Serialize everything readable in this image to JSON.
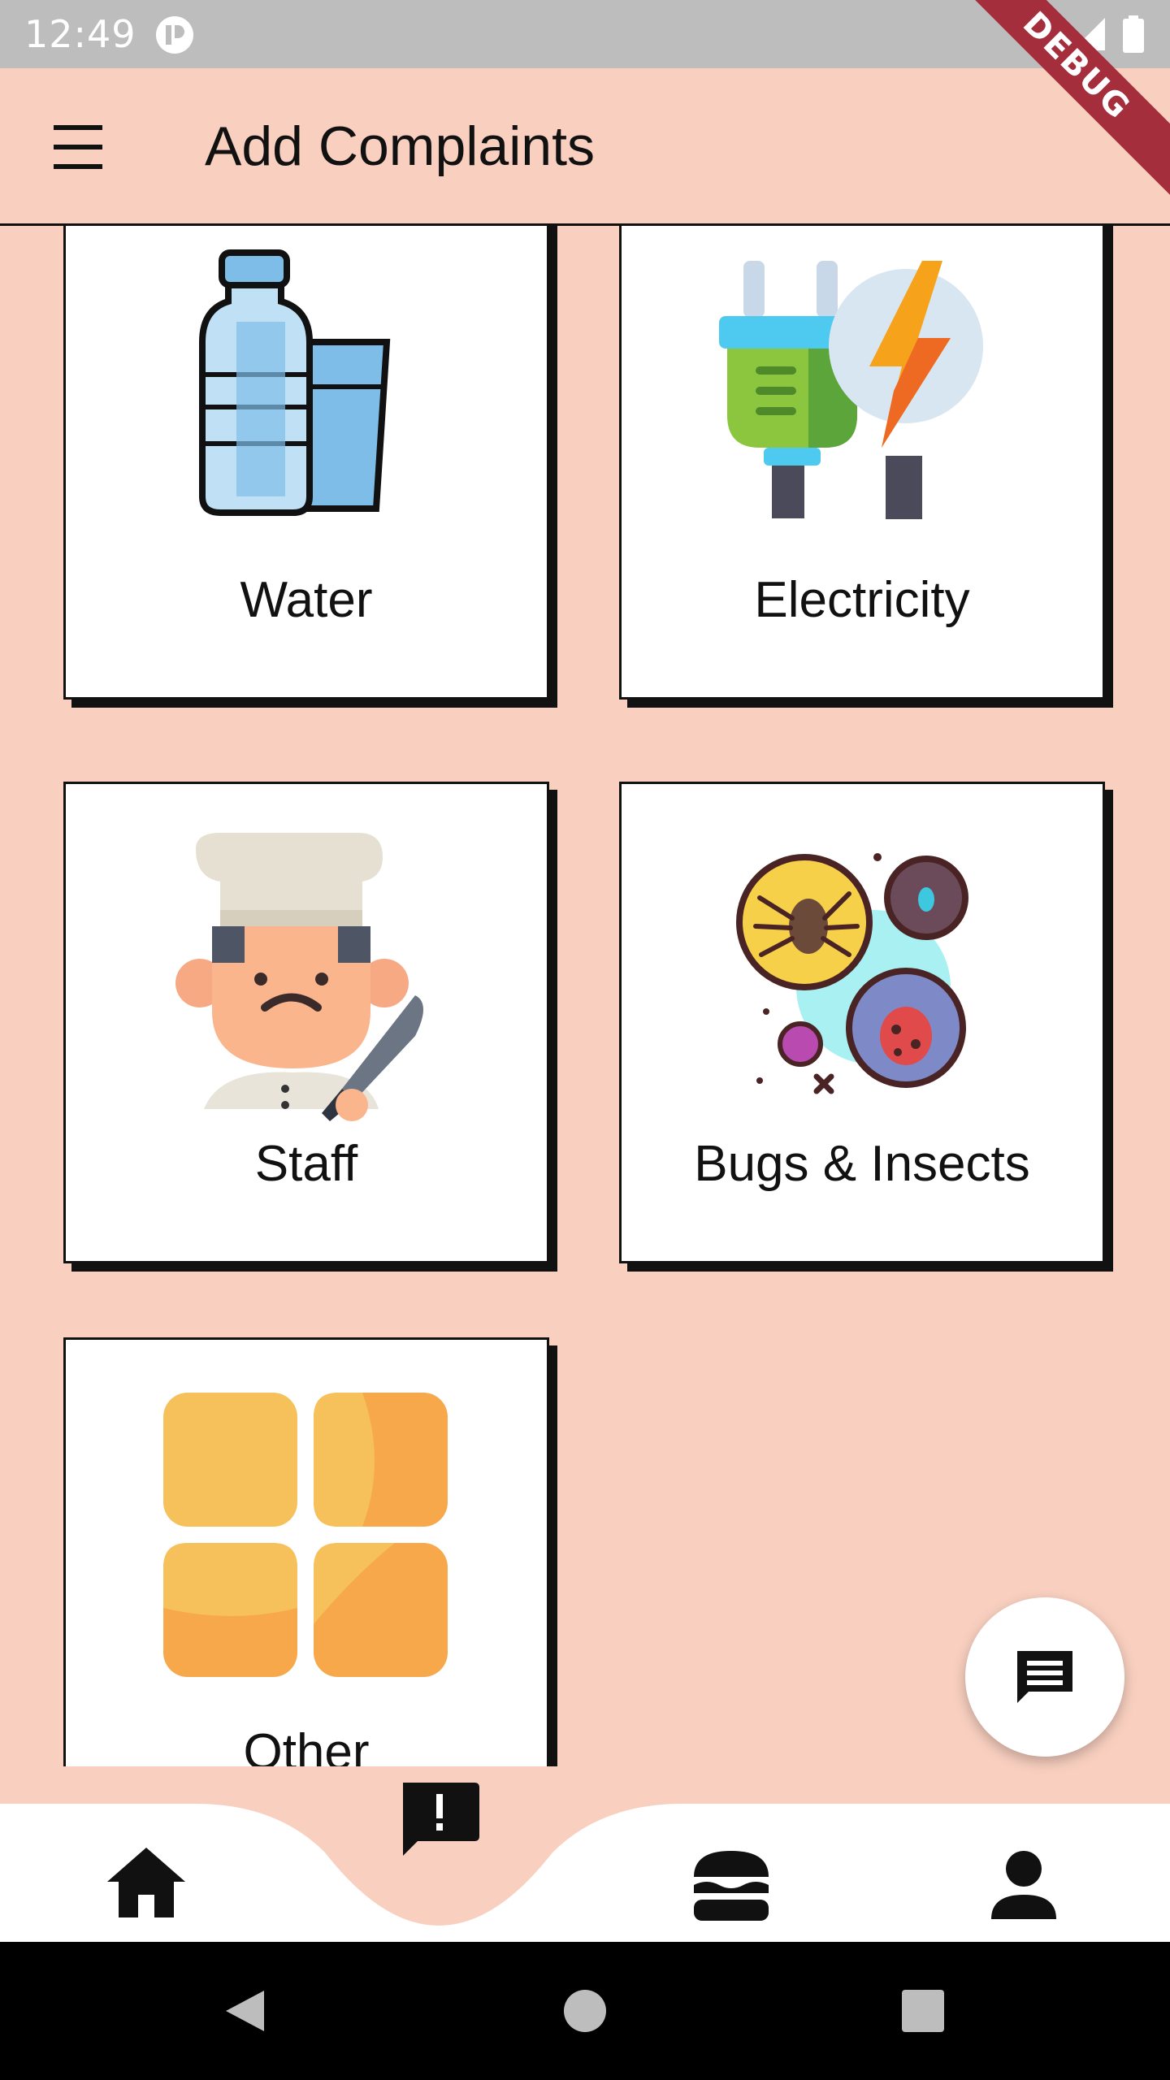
{
  "status_bar": {
    "time": "12:49",
    "debug_label": "DEBUG"
  },
  "app_bar": {
    "title": "Add Complaints",
    "menu_icon": "menu-icon"
  },
  "categories": [
    {
      "label": "Water",
      "icon": "water-bottle-icon"
    },
    {
      "label": "Electricity",
      "icon": "plug-lightning-icon"
    },
    {
      "label": "Staff",
      "icon": "chef-icon"
    },
    {
      "label": "Bugs & Insects",
      "icon": "bugs-icon"
    },
    {
      "label": "Other",
      "icon": "grid-tiles-icon"
    }
  ],
  "fab": {
    "icon": "chat-icon"
  },
  "bottom_nav": {
    "items": [
      {
        "icon": "home-icon"
      },
      {
        "icon": "complaint-icon",
        "active": true
      },
      {
        "icon": "food-icon"
      },
      {
        "icon": "person-icon"
      }
    ],
    "active_color": "#F9D0C0"
  },
  "colors": {
    "background": "#F9D0C0",
    "card": "#ffffff",
    "outline": "#111111"
  }
}
